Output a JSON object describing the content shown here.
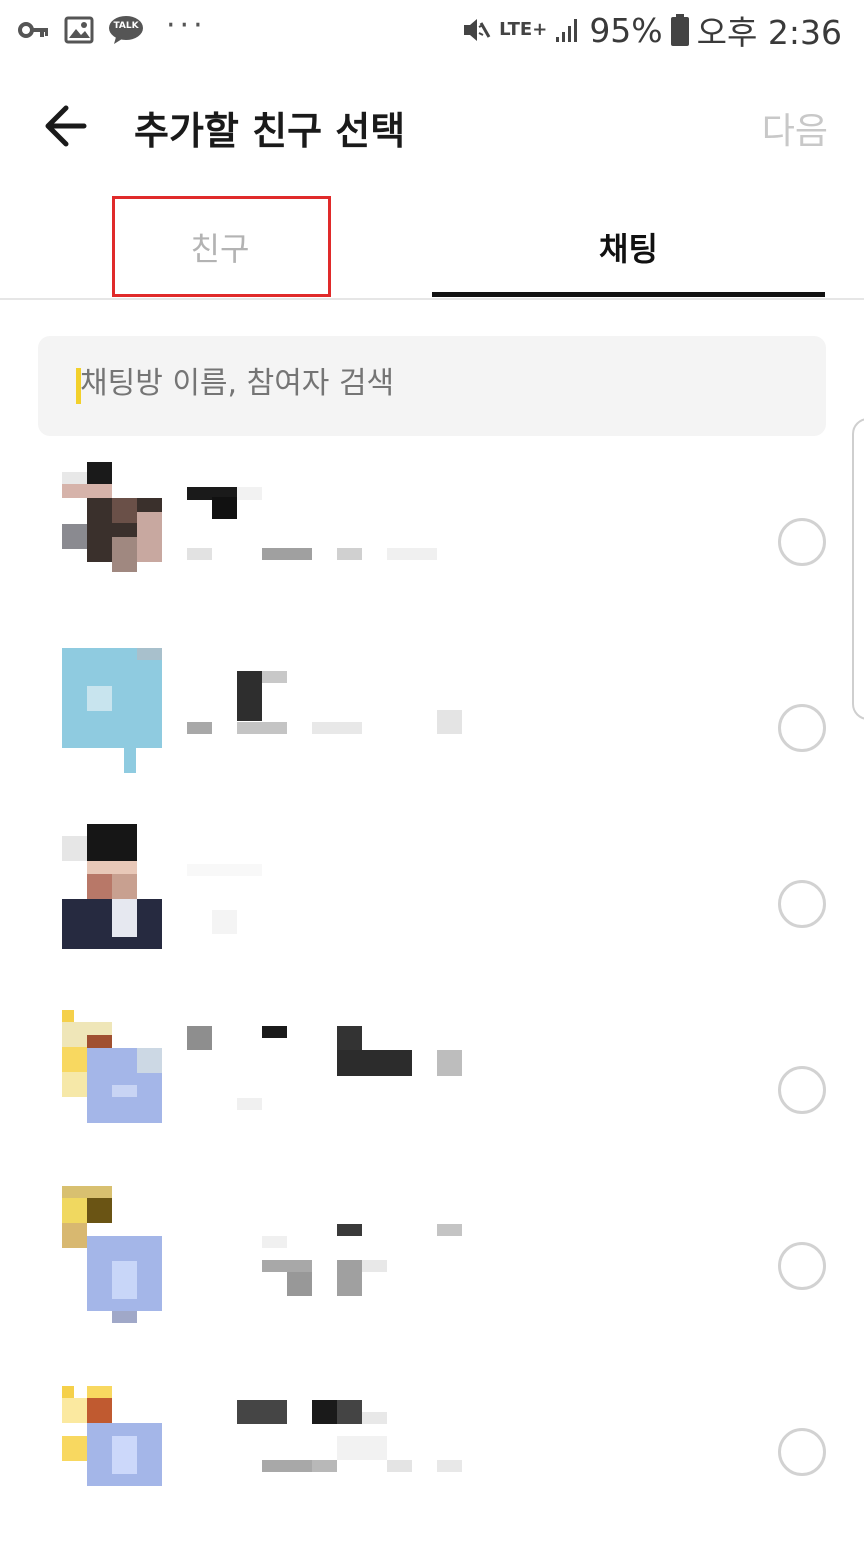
{
  "status_bar": {
    "talk_badge": "TALK",
    "more": "···",
    "network": "LTE+",
    "battery": "95%",
    "time": "오후 2:36"
  },
  "appbar": {
    "title": "추가할 친구 선택",
    "next_label": "다음"
  },
  "tabs": [
    {
      "label": "친구",
      "selected": false
    },
    {
      "label": "채팅",
      "selected": true
    }
  ],
  "search": {
    "placeholder": "채팅방 이름, 참여자 검색"
  },
  "colors": {
    "accent_caret": "#f2d02b",
    "highlight_box": "#e02a2a",
    "tab_active": "#111111",
    "disabled_text": "#c8c8c8"
  },
  "chat_rooms": [
    {
      "avatar": "group-photo",
      "selected": false
    },
    {
      "avatar": "default-blue",
      "selected": false
    },
    {
      "avatar": "person-photo",
      "selected": false
    },
    {
      "avatar": "group-default",
      "selected": false
    },
    {
      "avatar": "group-default",
      "selected": false
    },
    {
      "avatar": "group-default",
      "selected": false
    }
  ]
}
